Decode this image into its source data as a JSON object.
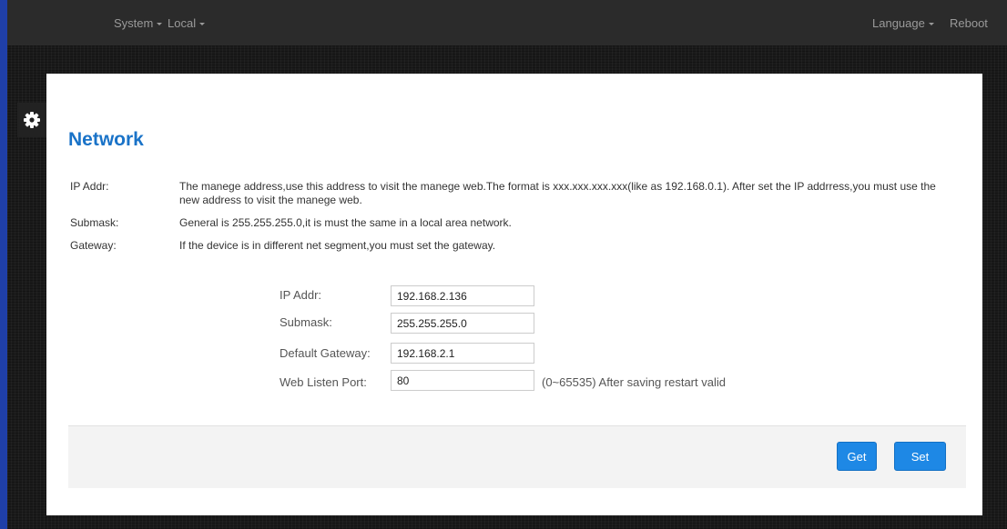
{
  "nav": {
    "system": "System",
    "local": "Local",
    "language": "Language",
    "reboot": "Reboot"
  },
  "page": {
    "title": "Network"
  },
  "help": [
    {
      "label": "IP Addr:",
      "text": "The manege address,use this address to visit the manege web.The format is xxx.xxx.xxx.xxx(like as 192.168.0.1). After set the IP addrress,you must use the new address to visit the manege web."
    },
    {
      "label": "Submask:",
      "text": "General is 255.255.255.0,it is must the same in a local area network."
    },
    {
      "label": "Gateway:",
      "text": "If the device is in different net segment,you must set the gateway."
    }
  ],
  "form": {
    "ip": {
      "label": "IP Addr:",
      "value": "192.168.2.136"
    },
    "submask": {
      "label": "Submask:",
      "value": "255.255.255.0"
    },
    "gateway": {
      "label": "Default Gateway:",
      "value": "192.168.2.1"
    },
    "port": {
      "label": "Web Listen Port:",
      "value": "80",
      "note": "(0~65535) After saving restart valid"
    }
  },
  "buttons": {
    "get": "Get",
    "set": "Set"
  },
  "icons": {
    "settings": "gear-icon"
  },
  "colors": {
    "accent": "#1e88e5",
    "title": "#1a73c8",
    "topbar": "#2b2b2b",
    "left_edge": "#1f3fa8"
  }
}
